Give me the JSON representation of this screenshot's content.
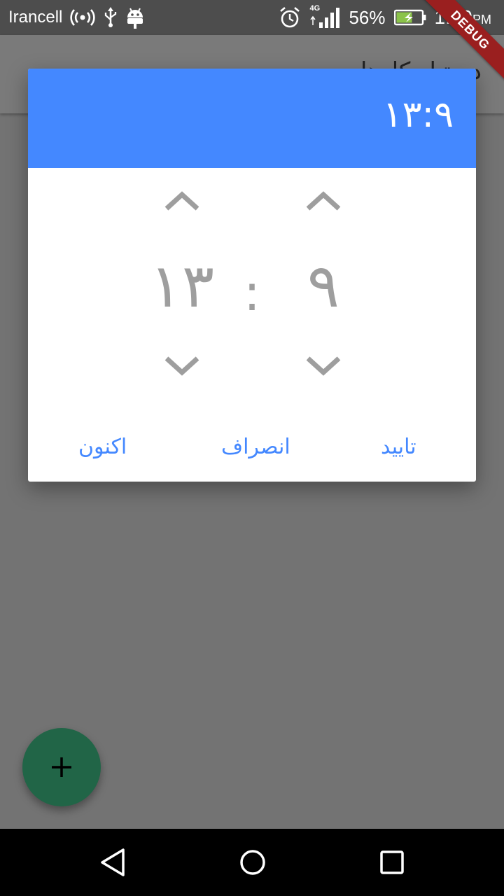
{
  "status_bar": {
    "carrier": "Irancell",
    "network": "4G",
    "battery": "56%",
    "time": "1:09",
    "ampm": "PM",
    "icons": [
      "hotspot-icon",
      "usb-icon",
      "android-icon",
      "alarm-icon",
      "signal-icon",
      "battery-charging-icon"
    ]
  },
  "debug_banner": "DEBUG",
  "app_bar": {
    "title": "دستیار کارها"
  },
  "time_picker": {
    "header_time": "۱۳:۹",
    "hours": "۱۳",
    "minutes": "۹",
    "separator": ":",
    "actions": {
      "now": "اکنون",
      "cancel": "انصراف",
      "confirm": "تایید"
    }
  },
  "fab": {
    "icon": "plus-icon"
  },
  "colors": {
    "header": "#4488ff",
    "accent": "#4488ff",
    "fab": "#216547",
    "scrim": "#737373",
    "spinner_text": "#9e9e9e"
  }
}
